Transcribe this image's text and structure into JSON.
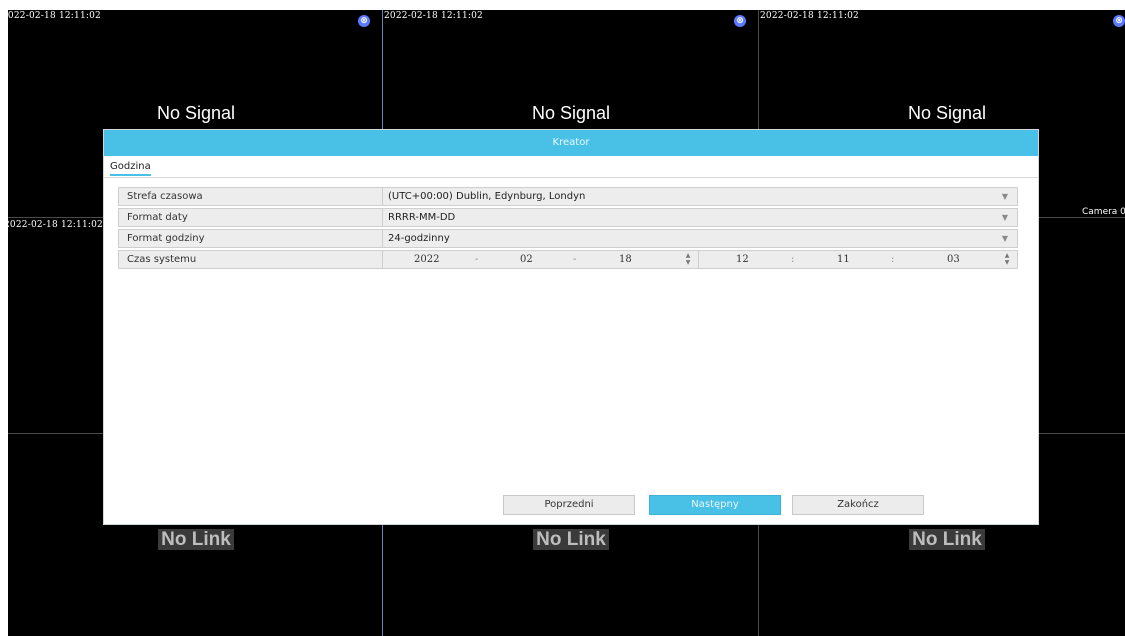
{
  "background": {
    "timestamp": "2022-02-18 12:11:02",
    "no_signal": "No Signal",
    "no_link": "No Link",
    "camera_label": "Camera 0"
  },
  "dialog": {
    "title": "Kreator",
    "tab": "Godzina",
    "rows": [
      {
        "label": "Strefa czasowa",
        "value": "(UTC+00:00) Dublin, Edynburg, Londyn"
      },
      {
        "label": "Format daty",
        "value": "RRRR-MM-DD"
      },
      {
        "label": "Format godziny",
        "value": "24-godzinny"
      },
      {
        "label": "Czas systemu"
      }
    ],
    "system_time": {
      "year": "2022",
      "month": "02",
      "day": "18",
      "hour": "12",
      "minute": "11",
      "second": "03",
      "date_sep": "-",
      "time_sep": ":"
    },
    "buttons": {
      "prev": "Poprzedni",
      "next": "Następny",
      "finish": "Zakończ"
    }
  },
  "colors": {
    "accent": "#49c0e5",
    "camera_icon": "#5b7bff"
  }
}
